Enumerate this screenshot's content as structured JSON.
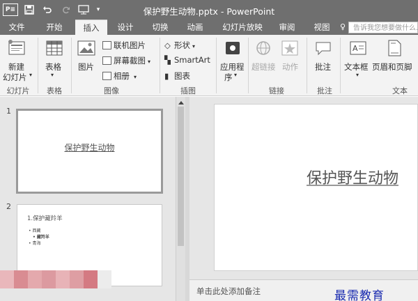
{
  "window": {
    "title": "保护野生动物.pptx - PowerPoint",
    "app_badge": "P≡"
  },
  "qat": {
    "save_icon": "save-icon",
    "undo_icon": "undo-icon",
    "redo_icon": "redo-icon",
    "customize_icon": "customize-qat-icon"
  },
  "tabs": [
    "文件",
    "开始",
    "插入",
    "设计",
    "切换",
    "动画",
    "幻灯片放映",
    "审阅",
    "视图"
  ],
  "tellme_placeholder": "告诉我您想要做什么...",
  "ribbon": {
    "new_slide_line1": "新建",
    "new_slide_line2": "幻灯片",
    "table": "表格",
    "picture": "图片",
    "online_picture": "联机图片",
    "screenshot": "屏幕截图",
    "album": "相册",
    "shapes": "形状",
    "smartart": "SmartArt",
    "chart": "图表",
    "apps_line1": "应用程",
    "apps_line2": "序",
    "hyperlink": "超链接",
    "action": "动作",
    "comment": "批注",
    "textbox": "文本框",
    "header_footer": "页眉和页脚",
    "groups": {
      "slides": "幻灯片",
      "tables": "表格",
      "images": "图像",
      "illustrations": "插图",
      "links": "链接",
      "comments": "批注",
      "text": "文本"
    }
  },
  "thumbnails": [
    {
      "number": "1",
      "title": "保护野生动物"
    },
    {
      "number": "2",
      "title": "1.保护藏羚羊",
      "bullets": [
        "• 西藏",
        "• 藏羚羊",
        "• 青海"
      ]
    }
  ],
  "slide": {
    "title": "保护野生动物"
  },
  "notes_placeholder": "单击此处添加备注",
  "watermark": "最需教育"
}
